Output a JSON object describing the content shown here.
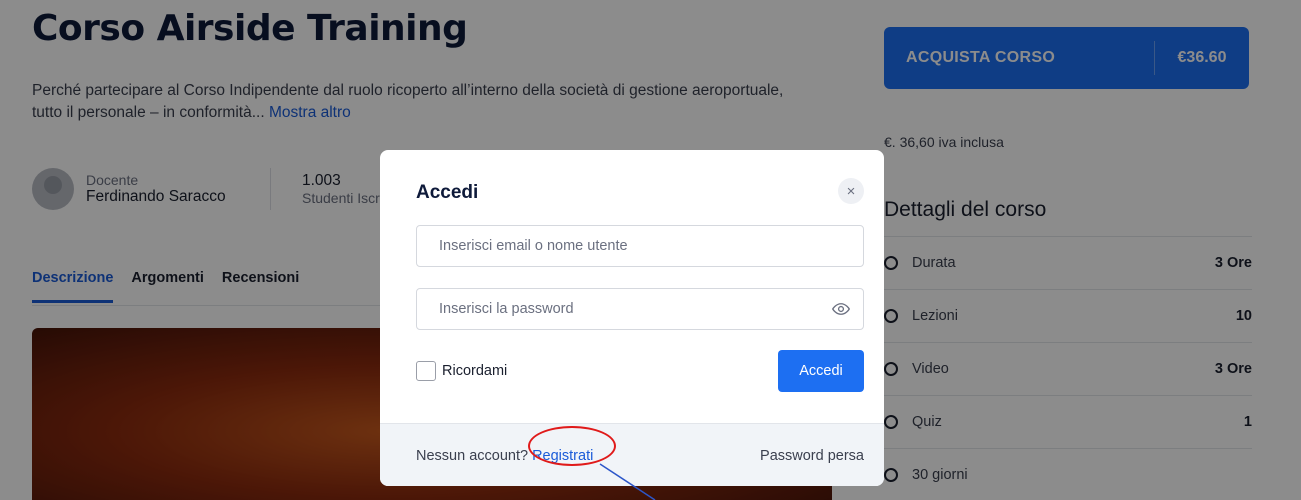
{
  "course": {
    "title": "Corso Airside Training",
    "description": "Perché partecipare al Corso Indipendente dal ruolo ricoperto all’interno della società di gestione aeroportuale, tutto il personale – in conformità...",
    "show_more": "Mostra altro",
    "teacher_label": "Docente",
    "teacher_name": "Ferdinando Saracco",
    "students_count": "1.003",
    "students_label": "Studenti Iscritti"
  },
  "tabs": [
    {
      "label": "Descrizione",
      "active": true
    },
    {
      "label": "Argomenti",
      "active": false
    },
    {
      "label": "Recensioni",
      "active": false
    }
  ],
  "sidebar": {
    "buy_label": "ACQUISTA CORSO",
    "buy_price": "€36.60",
    "vat_note": "€. 36,60 iva inclusa",
    "details_title": "Dettagli del corso",
    "details": [
      {
        "label": "Durata",
        "value": "3 Ore"
      },
      {
        "label": "Lezioni",
        "value": "10"
      },
      {
        "label": "Video",
        "value": "3 Ore"
      },
      {
        "label": "Quiz",
        "value": "1"
      },
      {
        "label": "30 giorni",
        "value": ""
      }
    ]
  },
  "login_modal": {
    "title": "Accedi",
    "email_placeholder": "Inserisci email o nome utente",
    "password_placeholder": "Inserisci la password",
    "remember_label": "Ricordami",
    "submit_label": "Accedi",
    "no_account_text": "Nessun account?",
    "register_label": "Registrati",
    "lost_password_label": "Password persa",
    "close_glyph": "×"
  },
  "colors": {
    "accent": "#1d6ff2",
    "annotation": "#e01a1a"
  }
}
